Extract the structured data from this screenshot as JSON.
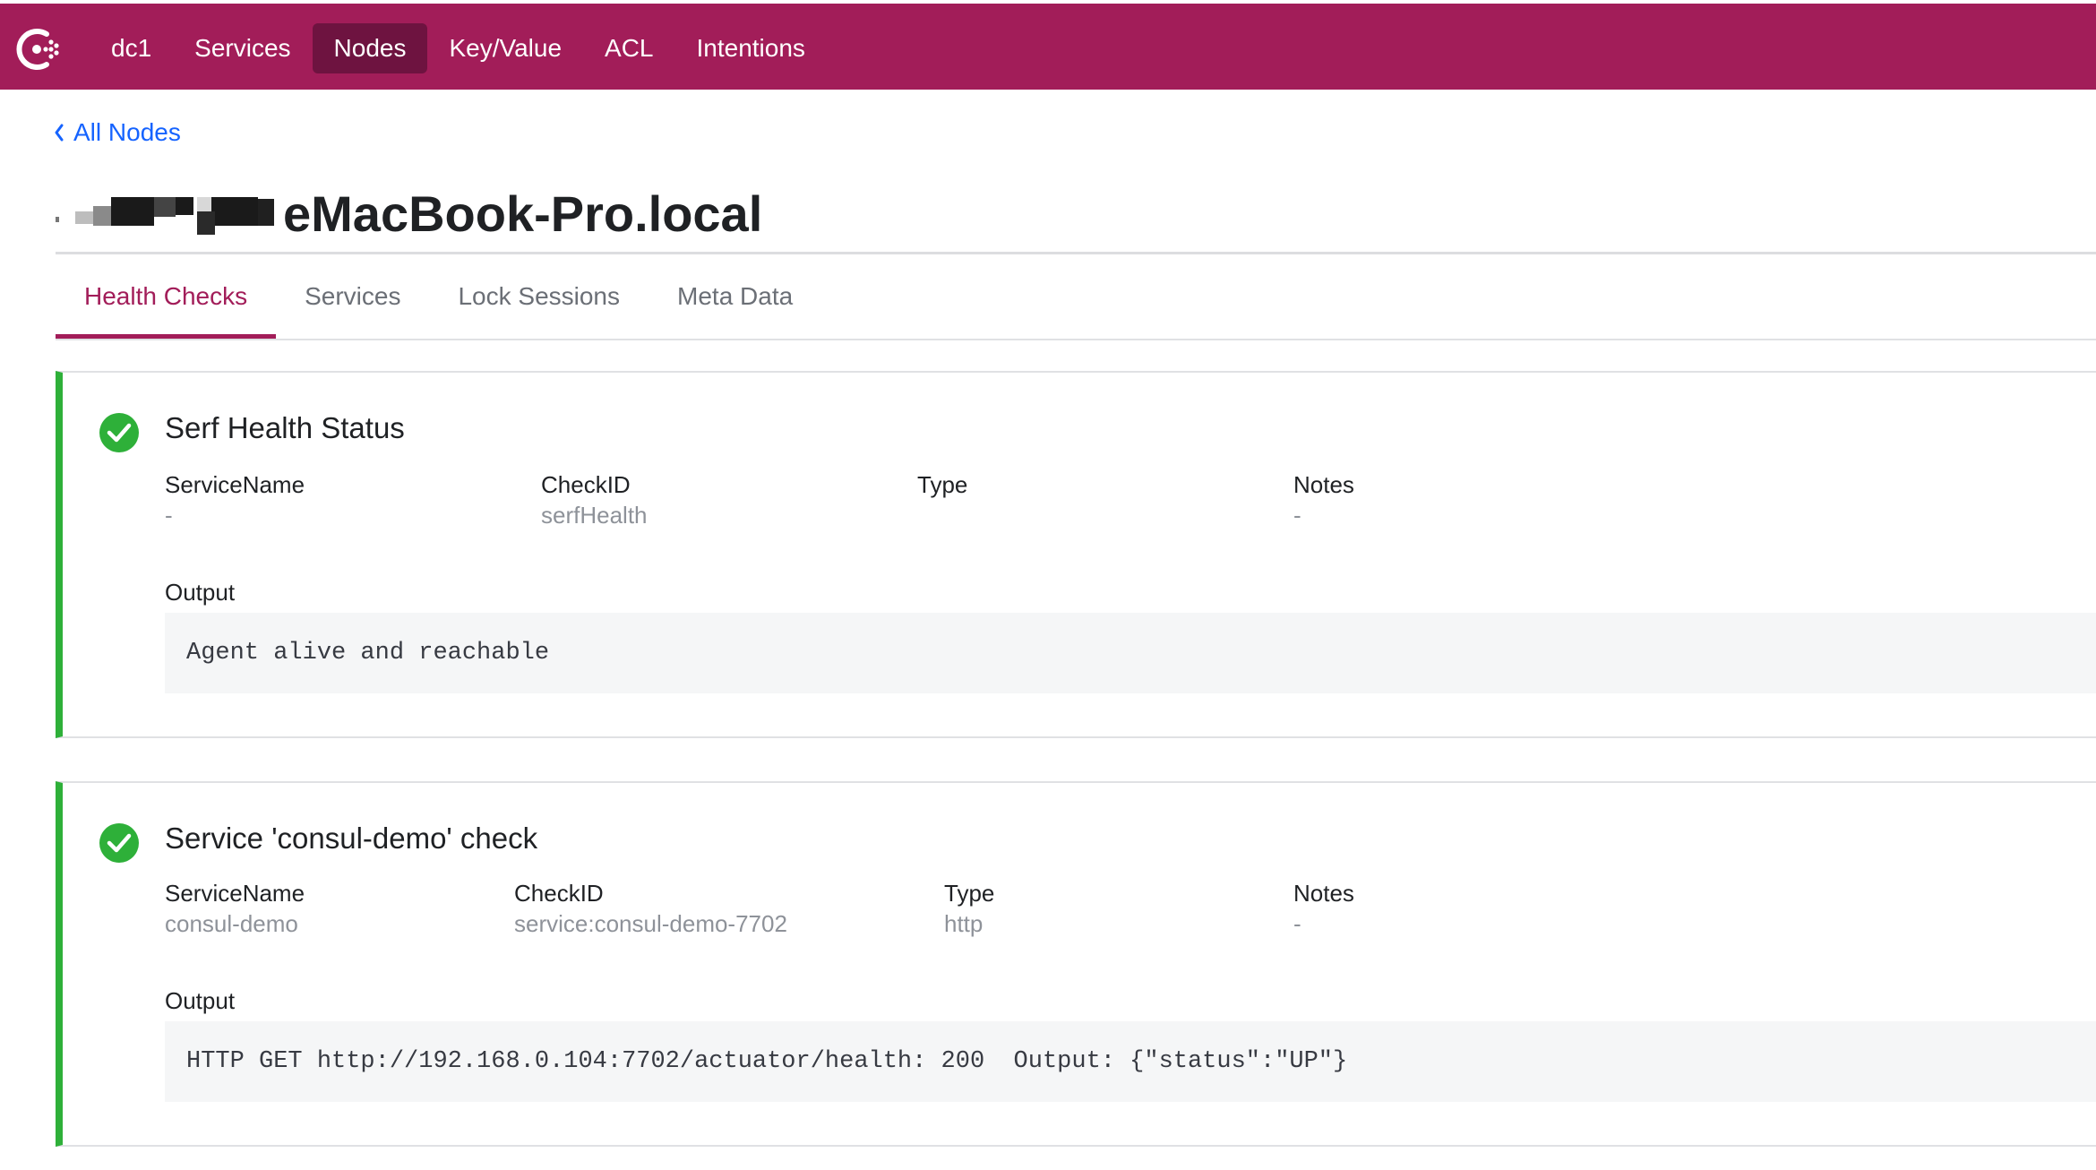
{
  "colors": {
    "brand": "#a21d59",
    "brand_active": "#6e1340",
    "link": "#1563ff",
    "passing": "#2eb039"
  },
  "nav": {
    "logo_icon": "consul-logo-icon",
    "items": [
      {
        "label": "dc1",
        "active": false
      },
      {
        "label": "Services",
        "active": false
      },
      {
        "label": "Nodes",
        "active": true
      },
      {
        "label": "Key/Value",
        "active": false
      },
      {
        "label": "ACL",
        "active": false
      },
      {
        "label": "Intentions",
        "active": false
      }
    ]
  },
  "breadcrumb": {
    "label": "All Nodes",
    "icon": "chevron-left-icon"
  },
  "page": {
    "title": "eMacBook-Pro.local"
  },
  "tabs": [
    {
      "label": "Health Checks",
      "active": true
    },
    {
      "label": "Services",
      "active": false
    },
    {
      "label": "Lock Sessions",
      "active": false
    },
    {
      "label": "Meta Data",
      "active": false
    }
  ],
  "checks": [
    {
      "status_icon": "check-circle-icon",
      "name": "Serf Health Status",
      "labels": {
        "service": "ServiceName",
        "check_id": "CheckID",
        "type": "Type",
        "notes": "Notes",
        "output": "Output"
      },
      "service_name": "-",
      "check_id": "serfHealth",
      "type": "",
      "notes": "-",
      "output": "Agent alive and reachable"
    },
    {
      "status_icon": "check-circle-icon",
      "name": "Service 'consul-demo' check",
      "labels": {
        "service": "ServiceName",
        "check_id": "CheckID",
        "type": "Type",
        "notes": "Notes",
        "output": "Output"
      },
      "service_name": "consul-demo",
      "check_id": "service:consul-demo-7702",
      "type": "http",
      "notes": "-",
      "output": "HTTP GET http://192.168.0.104:7702/actuator/health: 200  Output: {\"status\":\"UP\"}"
    }
  ]
}
